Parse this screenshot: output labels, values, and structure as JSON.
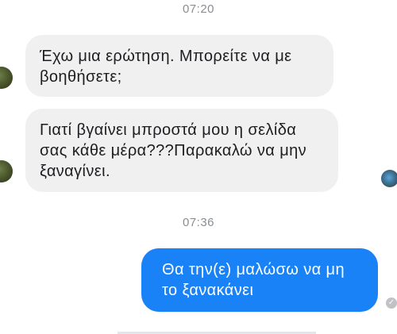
{
  "conversation": {
    "groups": [
      {
        "timestamp": "07:20",
        "messages": [
          {
            "text": "Έχω μια ερώτηση. Μπορείτε να με βοηθήσετε;"
          },
          {
            "text": "Γιατί βγαίνει μπροστά μου η σελίδα σας κάθε μέρα???Παρακαλώ να μην ξαναγίνει."
          }
        ]
      },
      {
        "timestamp": "07:36",
        "messages": [
          {
            "text": "Θα την(ε) μαλώσω να μη το ξανακάνει"
          }
        ]
      }
    ]
  },
  "colors": {
    "incoming_bubble": "#f1f0f0",
    "outgoing_bubble": "#1a82f7",
    "timestamp": "#8a8d91"
  },
  "icons": {
    "sender_avatar": "avatar",
    "read_receipt_avatar": "avatar",
    "delivered": "check-circle-icon"
  }
}
